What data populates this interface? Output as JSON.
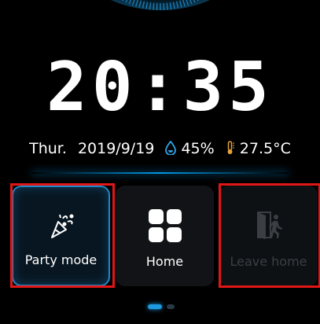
{
  "clock": {
    "time": "20:35"
  },
  "status": {
    "day": "Thur.",
    "date": "2019/9/19",
    "humidity": "45%",
    "temperature": "27.5°C"
  },
  "modes": [
    {
      "label": "Party mode",
      "icon": "party-popper-icon",
      "state": "active"
    },
    {
      "label": "Home",
      "icon": "grid-icon",
      "state": "normal"
    },
    {
      "label": "Leave home",
      "icon": "leave-home-icon",
      "state": "disabled"
    }
  ],
  "pager": {
    "pages": 2,
    "current": 1
  },
  "colors": {
    "accent": "#1e9be0",
    "highlight": "#e11616",
    "background": "#000000"
  }
}
